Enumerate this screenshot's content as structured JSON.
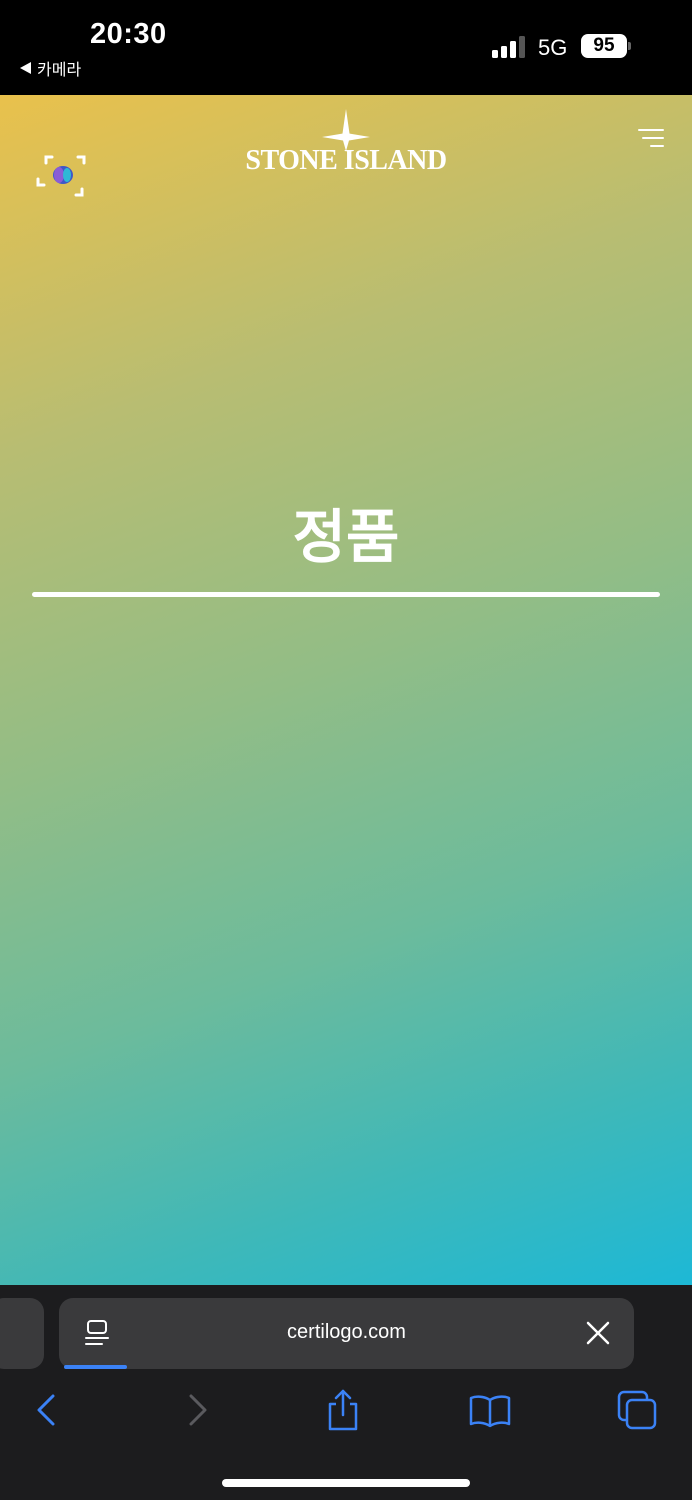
{
  "status_bar": {
    "time": "20:30",
    "back_app": "카메라",
    "network": "5G",
    "battery": "95"
  },
  "header": {
    "brand": "STONE ISLAND",
    "scan_icon": "scan-frame-icon",
    "menu_icon": "menu-icon"
  },
  "result": {
    "title": "정품"
  },
  "safari": {
    "url": "certilogo.com",
    "page_icon": "reader-icon",
    "close_icon": "close-icon",
    "toolbar_icons": [
      "back-icon",
      "forward-icon",
      "share-icon",
      "bookmarks-icon",
      "tabs-icon"
    ],
    "accent": "#3b82f6"
  },
  "colors": {
    "gradient_top": "#e9c14c",
    "gradient_bottom": "#1db8d6"
  }
}
